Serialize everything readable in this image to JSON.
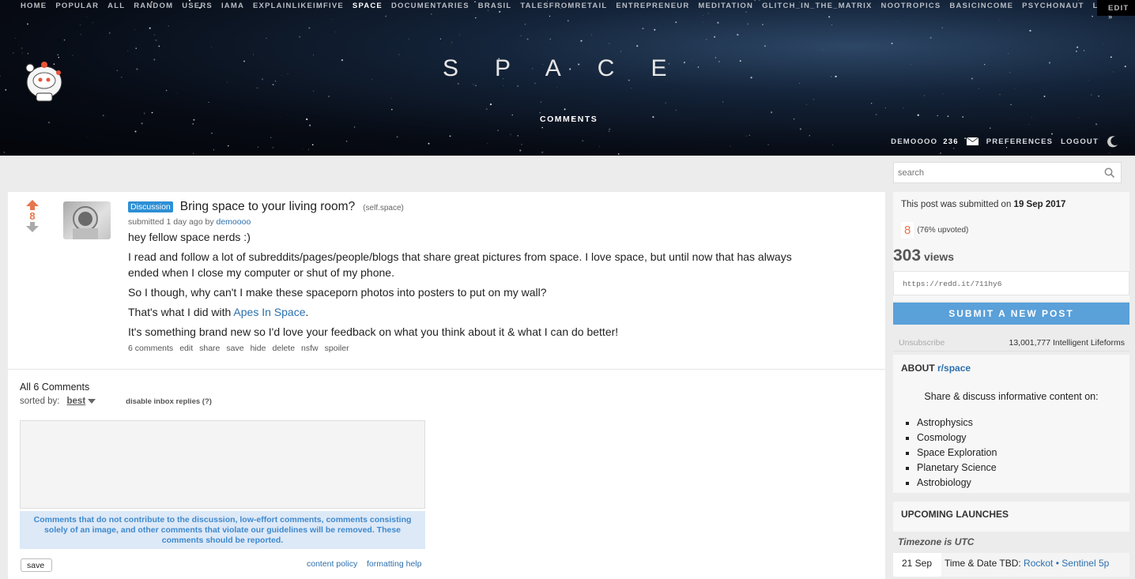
{
  "nav": {
    "links": [
      "HOME",
      "POPULAR",
      "ALL",
      "RANDOM",
      "USERS",
      "IAMA",
      "EXPLAINLIKEIMFIVE",
      "SPACE",
      "DOCUMENTARIES",
      "BRASIL",
      "TALESFROMRETAIL",
      "ENTREPRENEUR",
      "MEDITATION",
      "GLITCH_IN_THE_MATRIX",
      "NOOTROPICS",
      "BASICINCOME",
      "PSYCHONAUT",
      "LUCIDDREAMING"
    ],
    "active": "SPACE",
    "edit_label": "EDIT »"
  },
  "header": {
    "site_title": "SPACE",
    "tab_label": "COMMENTS",
    "username": "DEMOOOO",
    "karma": "236",
    "preferences_label": "PREFERENCES",
    "logout_label": "LOGOUT"
  },
  "post": {
    "score": "8",
    "flair": "Discussion",
    "title": "Bring space to your living room?",
    "domain": "(self.space)",
    "tagline_prefix": "submitted 1 day ago by",
    "author": "demoooo",
    "body_p1": "hey fellow space nerds :)",
    "body_p2": "I read and follow a lot of subreddits/pages/people/blogs that share great pictures from space. I love space, but until now that has always ended when I close my computer or shut of my phone.",
    "body_p3": "So I though, why can't I make these spaceporn photos into posters to put on my wall?",
    "body_p4_prefix": "That's what I did with",
    "body_p4_link": "Apes In Space",
    "body_p4_suffix": ".",
    "body_p5": "It's something brand new so I'd love your feedback on what you think about it & what I can do better!",
    "actions": [
      "6 comments",
      "edit",
      "share",
      "save",
      "hide",
      "delete",
      "nsfw",
      "spoiler"
    ]
  },
  "comments": {
    "heading": "All 6 Comments",
    "sorted_label": "sorted by:",
    "sort_value": "best",
    "disable_inbox": "disable inbox replies",
    "disable_inbox_help": "(?)",
    "textarea_value": "",
    "guideline": "Comments that do not contribute to the discussion, low-effort comments, comments consisting solely of an image, and other comments that violate our guidelines will be removed. These comments should be reported.",
    "save_label": "save",
    "content_policy": "content policy",
    "formatting_help": "formatting help"
  },
  "sidebar": {
    "search_placeholder": "search",
    "submitted_prefix": "This post was submitted on",
    "submitted_date": "19 Sep 2017",
    "score": "8",
    "upvoted": "(76% upvoted)",
    "views_num": "303",
    "views_label": "views",
    "shortlink": "https://redd.it/711hy6",
    "submit_label": "SUBMIT A NEW POST",
    "unsubscribe": "Unsubscribe",
    "subscribers": "13,001,777 Intelligent Lifeforms",
    "about_prefix": "ABOUT",
    "about_sub": "r/space",
    "about_desc": "Share & discuss informative content on:",
    "topics": [
      "Astrophysics",
      "Cosmology",
      "Space Exploration",
      "Planetary Science",
      "Astrobiology"
    ],
    "launches_title": "UPCOMING LAUNCHES",
    "timezone": "Timezone is UTC",
    "launch_date": "21 Sep",
    "launch_prefix": "Time & Date TBD:",
    "launch_link": "Rockot • Sentinel 5p"
  },
  "colors": {
    "upvote": "#e8764d",
    "link": "#2d70ad",
    "flair_bg": "#2d8fd5",
    "submit_bg": "#5aa0d9"
  }
}
